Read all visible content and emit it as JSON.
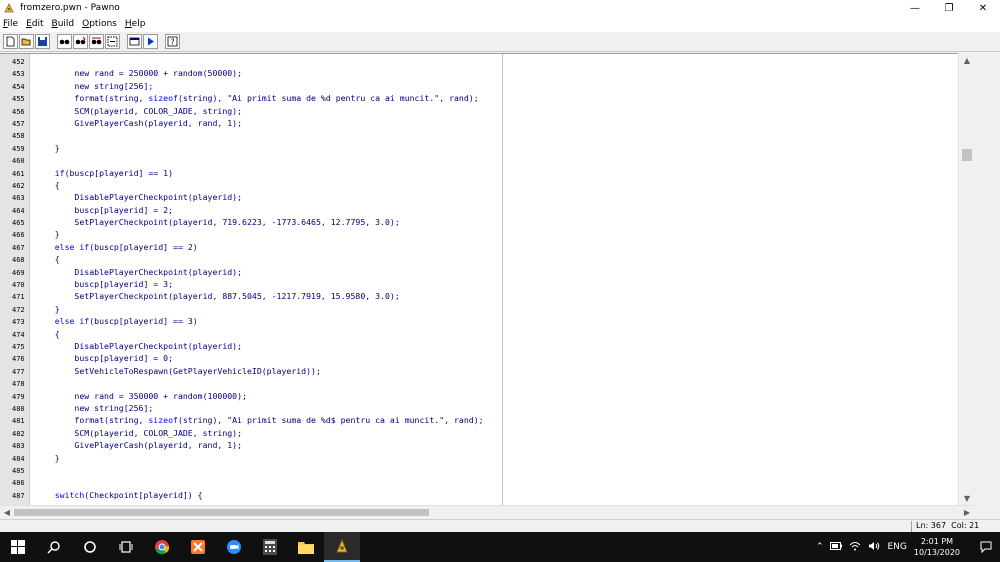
{
  "window": {
    "title": "fromzero.pwn - Pawno",
    "controls": [
      "minimize-icon",
      "restore-icon",
      "close-icon"
    ]
  },
  "menu": [
    {
      "label": "File",
      "underline": "F",
      "rest": "ile"
    },
    {
      "label": "Edit",
      "underline": "E",
      "rest": "dit"
    },
    {
      "label": "Build",
      "underline": "B",
      "rest": "uild"
    },
    {
      "label": "Options",
      "underline": "O",
      "rest": "ptions"
    },
    {
      "label": "Help",
      "underline": "H",
      "rest": "elp"
    }
  ],
  "toolbar": {
    "buttons": [
      "new-file-icon",
      "open-file-icon",
      "save-icon",
      "find-icon",
      "find-next-icon",
      "replace-icon",
      "goto-icon",
      "compile-options-icon",
      "run-icon",
      "help-icon"
    ]
  },
  "editor": {
    "lines": [
      {
        "n": "452",
        "code": ""
      },
      {
        "n": "453",
        "code": "        new rand = 250000 + random(50000);"
      },
      {
        "n": "454",
        "code": "        new string[256];"
      },
      {
        "n": "455",
        "code": "        format(string, sizeof(string), \"Ai primit suma de %d pentru ca ai muncit.\", rand);"
      },
      {
        "n": "456",
        "code": "        SCM(playerid, COLOR_JADE, string);"
      },
      {
        "n": "457",
        "code": "        GivePlayerCash(playerid, rand, 1);"
      },
      {
        "n": "458",
        "code": ""
      },
      {
        "n": "459",
        "code": "    }"
      },
      {
        "n": "460",
        "code": ""
      },
      {
        "n": "461",
        "code": "    if(buscp[playerid] == 1)"
      },
      {
        "n": "462",
        "code": "    {"
      },
      {
        "n": "463",
        "code": "        DisablePlayerCheckpoint(playerid);"
      },
      {
        "n": "464",
        "code": "        buscp[playerid] = 2;"
      },
      {
        "n": "465",
        "code": "        SetPlayerCheckpoint(playerid, 719.6223, -1773.6465, 12.7795, 3.0);"
      },
      {
        "n": "466",
        "code": "    }"
      },
      {
        "n": "467",
        "code": "    else if(buscp[playerid] == 2)"
      },
      {
        "n": "468",
        "code": "    {"
      },
      {
        "n": "469",
        "code": "        DisablePlayerCheckpoint(playerid);"
      },
      {
        "n": "470",
        "code": "        buscp[playerid] = 3;"
      },
      {
        "n": "471",
        "code": "        SetPlayerCheckpoint(playerid, 887.5045, -1217.7919, 15.9580, 3.0);"
      },
      {
        "n": "472",
        "code": "    }"
      },
      {
        "n": "473",
        "code": "    else if(buscp[playerid] == 3)"
      },
      {
        "n": "474",
        "code": "    {"
      },
      {
        "n": "475",
        "code": "        DisablePlayerCheckpoint(playerid);"
      },
      {
        "n": "476",
        "code": "        buscp[playerid] = 0;"
      },
      {
        "n": "477",
        "code": "        SetVehicleToRespawn(GetPlayerVehicleID(playerid));"
      },
      {
        "n": "478",
        "code": ""
      },
      {
        "n": "479",
        "code": "        new rand = 350000 + random(100000);"
      },
      {
        "n": "480",
        "code": "        new string[256];"
      },
      {
        "n": "481",
        "code": "        format(string, sizeof(string), \"Ai primit suma de %d$ pentru ca ai muncit.\", rand);"
      },
      {
        "n": "482",
        "code": "        SCM(playerid, COLOR_JADE, string);"
      },
      {
        "n": "483",
        "code": "        GivePlayerCash(playerid, rand, 1);"
      },
      {
        "n": "484",
        "code": "    }"
      },
      {
        "n": "485",
        "code": ""
      },
      {
        "n": "486",
        "code": ""
      },
      {
        "n": "487",
        "code": "    switch(Checkpoint[playerid]) {"
      }
    ]
  },
  "status": {
    "position": "Ln: 367  Col: 21"
  },
  "taskbar": {
    "items": [
      "start-icon",
      "search-icon",
      "cortana-icon",
      "task-view-icon",
      "chrome-icon",
      "xampp-icon",
      "zoom-icon",
      "calculator-icon",
      "file-explorer-icon",
      "pawno-icon"
    ],
    "language": "ENG",
    "time": "2:01 PM",
    "date": "10/13/2020"
  }
}
